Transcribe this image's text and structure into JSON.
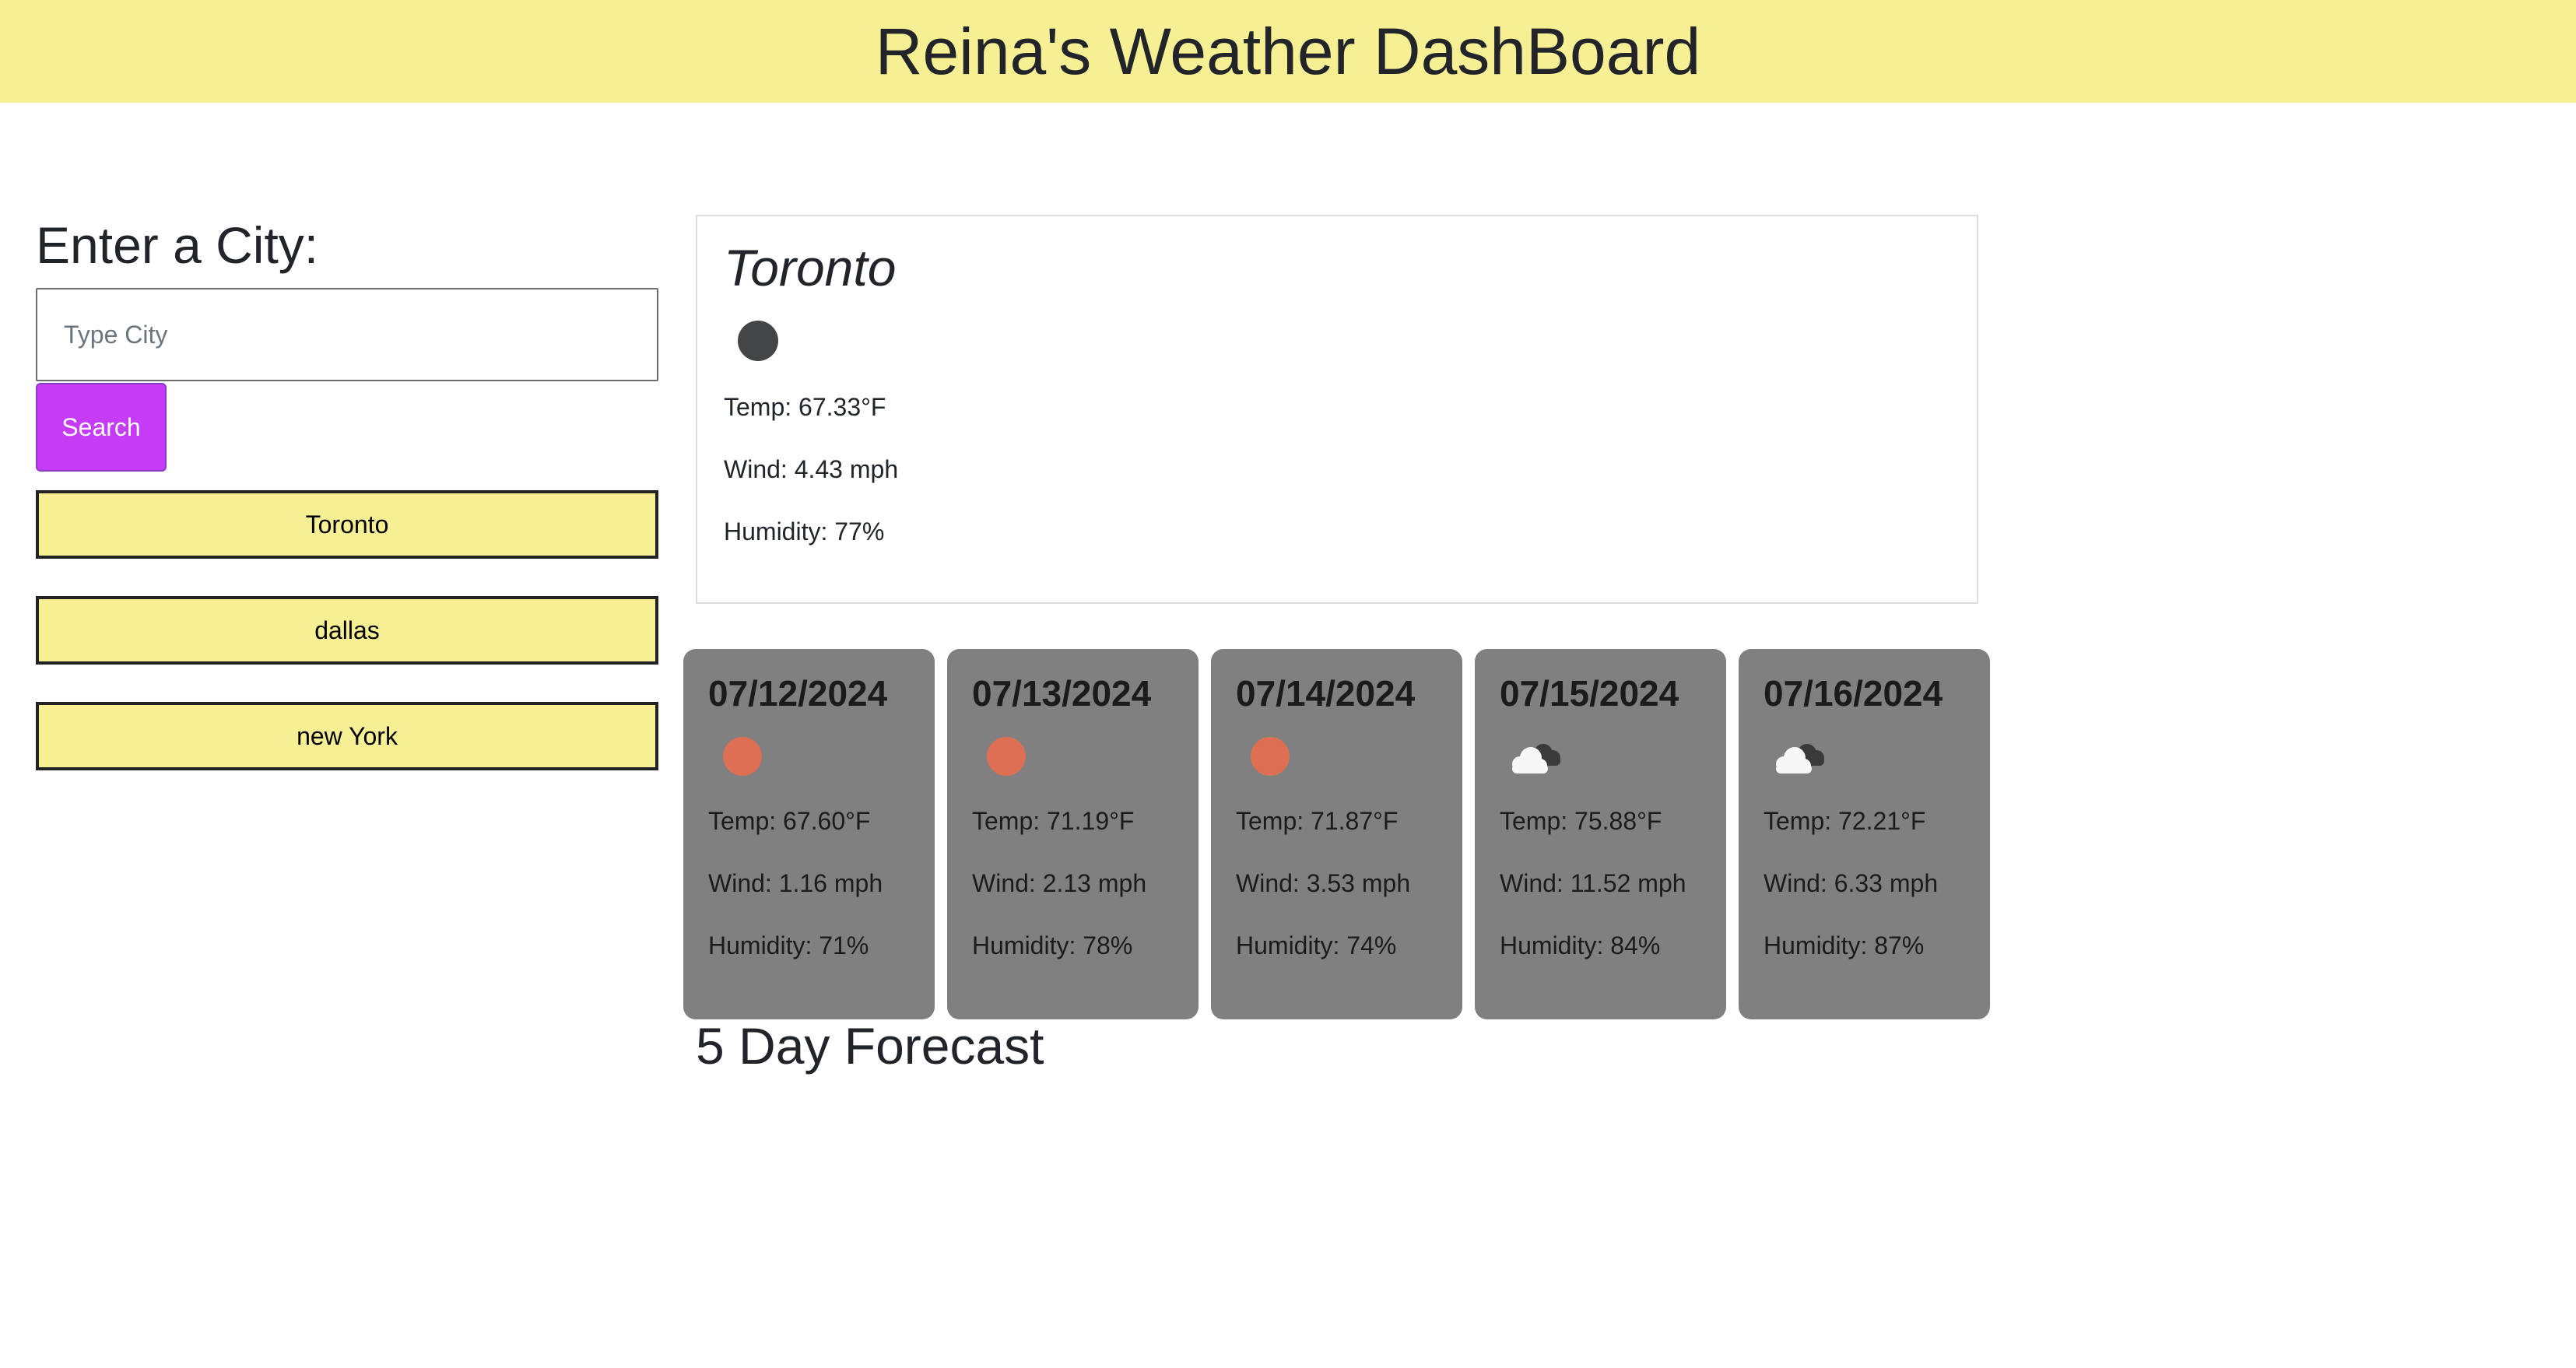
{
  "header": {
    "title": "Reina's Weather DashBoard"
  },
  "search": {
    "heading": "Enter a City:",
    "placeholder": "Type City",
    "value": "",
    "button_label": "Search"
  },
  "history": [
    "Toronto",
    "dallas",
    "new York"
  ],
  "current": {
    "city": "Toronto",
    "icon": "moon-icon",
    "temp": "Temp: 67.33°F",
    "wind": "Wind: 4.43 mph",
    "humidity": "Humidity: 77%"
  },
  "forecast_title": "5 Day Forecast",
  "forecast": [
    {
      "date": "07/12/2024",
      "icon": "sun-icon",
      "temp": "Temp: 67.60°F",
      "wind": "Wind: 1.16 mph",
      "humidity": "Humidity: 71%"
    },
    {
      "date": "07/13/2024",
      "icon": "sun-icon",
      "temp": "Temp: 71.19°F",
      "wind": "Wind: 2.13 mph",
      "humidity": "Humidity: 78%"
    },
    {
      "date": "07/14/2024",
      "icon": "sun-icon",
      "temp": "Temp: 71.87°F",
      "wind": "Wind: 3.53 mph",
      "humidity": "Humidity: 74%"
    },
    {
      "date": "07/15/2024",
      "icon": "clouds-icon",
      "temp": "Temp: 75.88°F",
      "wind": "Wind: 11.52 mph",
      "humidity": "Humidity: 84%"
    },
    {
      "date": "07/16/2024",
      "icon": "clouds-icon",
      "temp": "Temp: 72.21°F",
      "wind": "Wind: 6.33 mph",
      "humidity": "Humidity: 87%"
    }
  ],
  "colors": {
    "header_bg": "#f7ef94",
    "search_button": "#c63bf5",
    "history_button_bg": "#f7ef94",
    "forecast_card_bg": "#808080",
    "sun": "#df6f52",
    "moon": "#444546"
  }
}
